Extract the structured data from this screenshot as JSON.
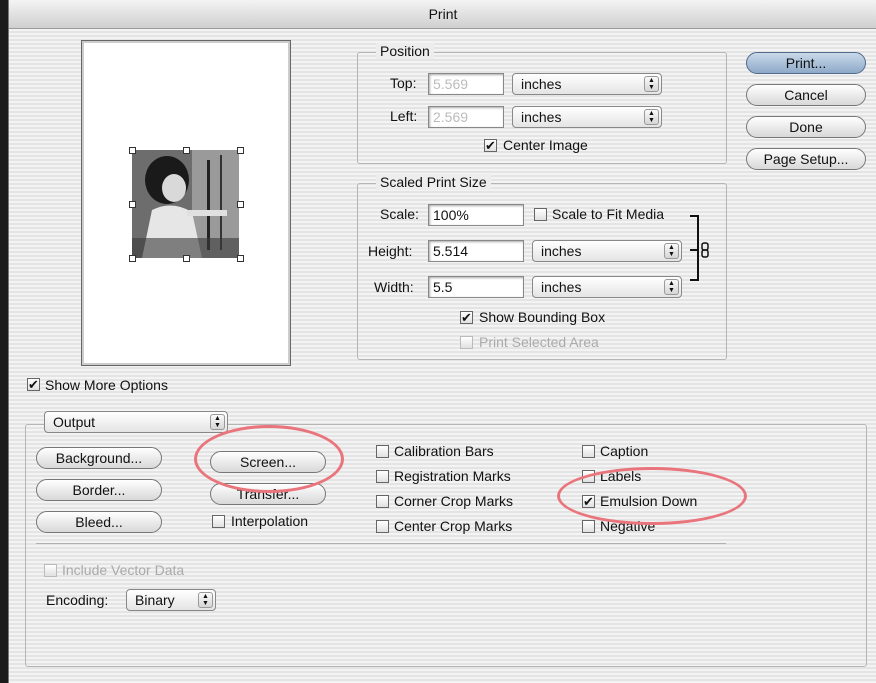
{
  "window": {
    "title": "Print"
  },
  "position": {
    "legend": "Position",
    "top_label": "Top:",
    "top_value": "5.569",
    "top_unit": "inches",
    "left_label": "Left:",
    "left_value": "2.569",
    "left_unit": "inches",
    "center_image": "Center Image",
    "center_image_checked": true
  },
  "scaled": {
    "legend": "Scaled Print Size",
    "scale_label": "Scale:",
    "scale_value": "100%",
    "fit_media": "Scale to Fit Media",
    "fit_media_checked": false,
    "height_label": "Height:",
    "height_value": "5.514",
    "height_unit": "inches",
    "width_label": "Width:",
    "width_value": "5.5",
    "width_unit": "inches",
    "show_bbox": "Show Bounding Box",
    "show_bbox_checked": true,
    "print_selected": "Print Selected Area",
    "print_selected_checked": false
  },
  "buttons": {
    "print": "Print...",
    "cancel": "Cancel",
    "done": "Done",
    "page_setup": "Page Setup..."
  },
  "more_options": {
    "label": "Show More Options",
    "checked": true
  },
  "output": {
    "selector": "Output",
    "background": "Background...",
    "border": "Border...",
    "bleed": "Bleed...",
    "screen": "Screen...",
    "transfer": "Transfer...",
    "interpolation": "Interpolation",
    "calibration_bars": "Calibration Bars",
    "registration_marks": "Registration Marks",
    "corner_crop_marks": "Corner Crop Marks",
    "center_crop_marks": "Center Crop Marks",
    "caption": "Caption",
    "labels": "Labels",
    "emulsion_down": "Emulsion Down",
    "emulsion_down_checked": true,
    "negative": "Negative",
    "include_vector": "Include Vector Data",
    "encoding_label": "Encoding:",
    "encoding_value": "Binary"
  },
  "annotations": {
    "highlight_color": "#e9747c"
  },
  "icons": [
    "checkmark-icon",
    "popup-arrows-icon",
    "link-chain-icon"
  ]
}
